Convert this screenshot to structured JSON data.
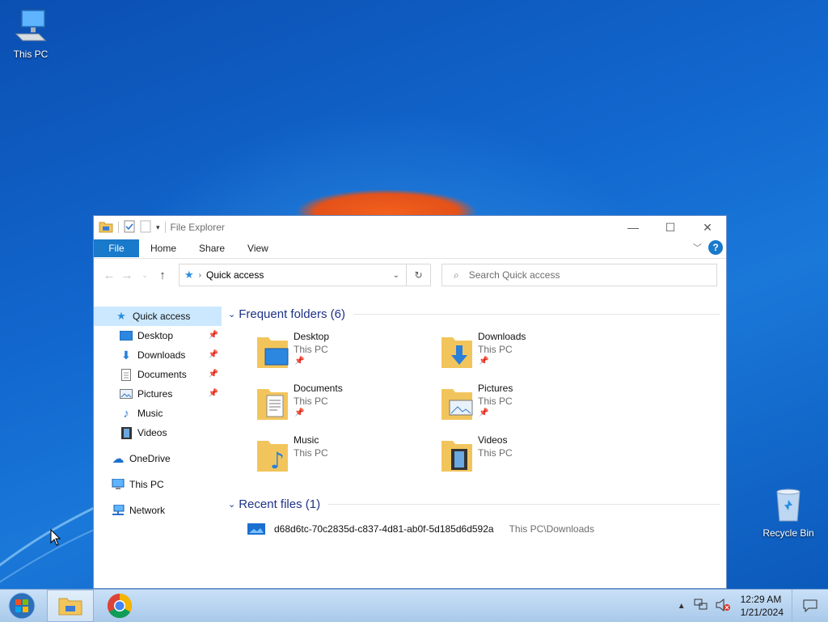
{
  "desktop": {
    "icons": [
      {
        "label": "This PC"
      },
      {
        "label": "Recycle Bin"
      }
    ]
  },
  "window": {
    "title": "File Explorer",
    "controls": {
      "minimize": "—",
      "maximize": "☐",
      "close": "✕"
    }
  },
  "ribbon": {
    "file": "File",
    "tabs": [
      "Home",
      "Share",
      "View"
    ],
    "help": "?"
  },
  "address": {
    "path": "Quick access",
    "search_placeholder": "Search Quick access"
  },
  "nav_pane": {
    "quick_access": "Quick access",
    "items": [
      "Desktop",
      "Downloads",
      "Documents",
      "Pictures",
      "Music",
      "Videos"
    ],
    "onedrive": "OneDrive",
    "this_pc": "This PC",
    "network": "Network"
  },
  "content": {
    "frequent_header": "Frequent folders (6)",
    "folders": [
      {
        "name": "Desktop",
        "location": "This PC",
        "pinned": true,
        "icon": "desktop-folder-icon"
      },
      {
        "name": "Downloads",
        "location": "This PC",
        "pinned": true,
        "icon": "downloads-folder-icon"
      },
      {
        "name": "Documents",
        "location": "This PC",
        "pinned": true,
        "icon": "documents-folder-icon"
      },
      {
        "name": "Pictures",
        "location": "This PC",
        "pinned": true,
        "icon": "pictures-folder-icon"
      },
      {
        "name": "Music",
        "location": "This PC",
        "pinned": false,
        "icon": "music-folder-icon"
      },
      {
        "name": "Videos",
        "location": "This PC",
        "pinned": false,
        "icon": "videos-folder-icon"
      }
    ],
    "recent_header": "Recent files (1)",
    "recent_files": [
      {
        "name": "d68d6tc-70c2835d-c837-4d81-ab0f-5d185d6d592a",
        "location": "This PC\\Downloads"
      }
    ]
  },
  "taskbar": {
    "apps": [
      "start",
      "file-explorer",
      "chrome"
    ],
    "clock": {
      "time": "12:29 AM",
      "date": "1/21/2024"
    }
  },
  "colors": {
    "accent": "#1979ca",
    "selection": "#cce8ff",
    "group_header": "#1e3287",
    "folder": "#f2c55c"
  }
}
